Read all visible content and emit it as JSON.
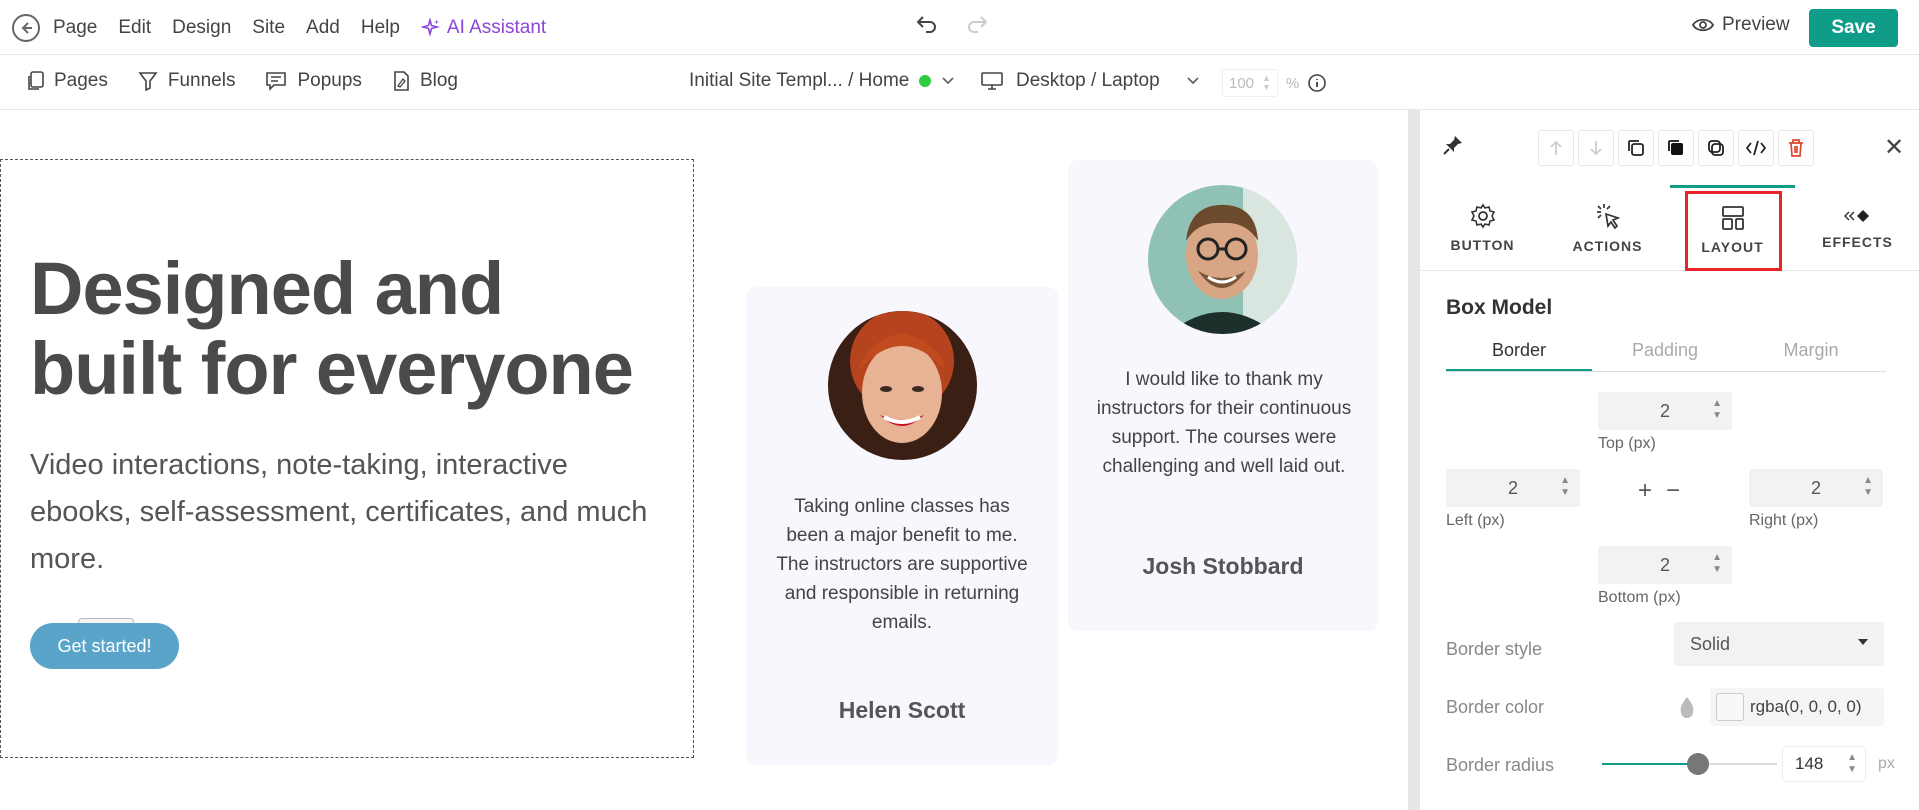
{
  "topbar": {
    "menu": [
      "Page",
      "Edit",
      "Design",
      "Site",
      "Add",
      "Help"
    ],
    "ai_label": "AI Assistant",
    "preview_label": "Preview",
    "save_label": "Save"
  },
  "subbar": {
    "navs": [
      "Pages",
      "Funnels",
      "Popups",
      "Blog"
    ],
    "page_select": "Initial Site Templ... / Home",
    "device": "Desktop / Laptop",
    "zoom_value": "100",
    "zoom_unit": "%"
  },
  "hero": {
    "title": "Designed and built for everyone",
    "subtitle": "Video interactions, note-taking, interactive ebooks, self-assessment, certificates, and much more.",
    "cta": "Get started!"
  },
  "testimonials": [
    {
      "quote": "Taking online classes has been a major benefit to me. The instructors are supportive and responsible in returning emails.",
      "name": "Helen Scott"
    },
    {
      "quote": "I would like to thank my instructors for their continuous support. The courses were challenging and well laid out.",
      "name": "Josh Stobbard"
    }
  ],
  "panel": {
    "tabs": [
      "BUTTON",
      "ACTIONS",
      "LAYOUT",
      "EFFECTS"
    ],
    "active_tab": "LAYOUT",
    "section_title": "Box Model",
    "box_tabs": [
      "Border",
      "Padding",
      "Margin"
    ],
    "border": {
      "top": "2",
      "top_label": "Top (px)",
      "left": "2",
      "left_label": "Left (px)",
      "right": "2",
      "right_label": "Right (px)",
      "bottom": "2",
      "bottom_label": "Bottom (px)"
    },
    "border_style_label": "Border style",
    "border_style_value": "Solid",
    "border_color_label": "Border color",
    "border_color_value": "rgba(0, 0, 0, 0)",
    "border_radius_label": "Border radius",
    "border_radius_value": "148",
    "border_radius_unit": "px",
    "border_radius_level": 0.55
  },
  "colors": {
    "accent": "#0f9d8a",
    "ai": "#8b46d9",
    "cta": "#5ba4c9",
    "highlight": "#e8232a",
    "delete": "#e0452b"
  }
}
